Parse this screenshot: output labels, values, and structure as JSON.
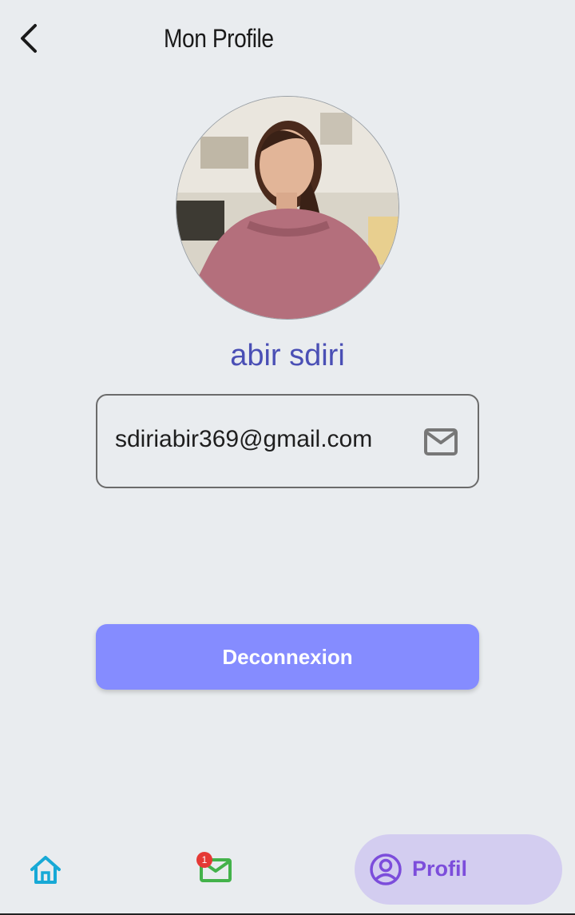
{
  "header": {
    "title": "Mon Profile",
    "back_icon": "chevron-left-icon"
  },
  "profile": {
    "name": "abir sdiri",
    "email": "sdiriabir369@gmail.com",
    "email_icon": "mail-icon",
    "logout_label": "Deconnexion"
  },
  "bottom_nav": {
    "items": [
      {
        "icon": "home-icon",
        "label": "",
        "active": false
      },
      {
        "icon": "mail-icon",
        "label": "",
        "badge": "1",
        "active": false
      },
      {
        "icon": "account-circle-icon",
        "label": "Profil",
        "active": true
      }
    ]
  },
  "colors": {
    "background": "#e9ecef",
    "name": "#4a4fb5",
    "button": "#858cff",
    "home_icon": "#17a9d6",
    "mail_nav_icon": "#43b24a",
    "active_tab_bg": "#d3cdf0",
    "active_tab_fg": "#7c4ddb",
    "badge": "#e53935"
  }
}
